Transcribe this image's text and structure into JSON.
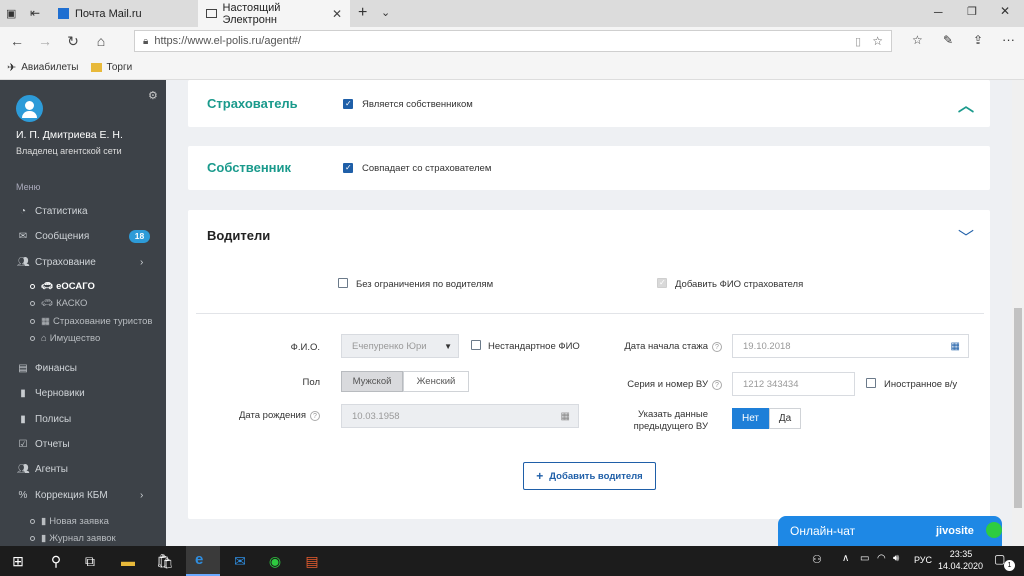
{
  "browser": {
    "tabs": [
      {
        "label": "Почта Mail.ru"
      },
      {
        "label": "Настоящий Электронн"
      }
    ],
    "url": "https://www.el-polis.ru/agent#/",
    "bookmarks": [
      {
        "label": "Авиабилеты"
      },
      {
        "label": "Торги"
      }
    ]
  },
  "sidebar": {
    "user_name": "И. П. Дмитриева Е. Н.",
    "user_role": "Владелец агентской сети",
    "menu_title": "Меню",
    "items": [
      {
        "label": "Статистика",
        "icon": "pie-chart-icon"
      },
      {
        "label": "Сообщения",
        "icon": "envelope-icon",
        "badge": "18"
      },
      {
        "label": "Страхование",
        "icon": "users-icon"
      },
      {
        "label": "Финансы",
        "icon": "money-icon"
      },
      {
        "label": "Черновики",
        "icon": "file-icon"
      },
      {
        "label": "Полисы",
        "icon": "file-icon"
      },
      {
        "label": "Отчеты",
        "icon": "check-icon"
      },
      {
        "label": "Агенты",
        "icon": "users-icon"
      },
      {
        "label": "Коррекция КБМ",
        "icon": "percent-icon"
      }
    ],
    "insurance_sub": [
      {
        "label": "еОСАГО"
      },
      {
        "label": "КАСКО"
      },
      {
        "label": "Страхование туристов"
      },
      {
        "label": "Имущество"
      }
    ],
    "kbm_sub": [
      {
        "label": "Новая заявка"
      },
      {
        "label": "Журнал заявок"
      }
    ]
  },
  "insurer": {
    "title": "Страхователь",
    "checkbox_label": "Является собственником",
    "checked": true
  },
  "owner": {
    "title": "Собственник",
    "checkbox_label": "Совпадает со страхователем",
    "checked": true
  },
  "drivers": {
    "title": "Водители",
    "unlimited_label": "Без ограничения по водителям",
    "add_insurer_label": "Добавить ФИО страхователя",
    "fio_label": "Ф.И.О.",
    "fio_value": "Ечепуренко Юри",
    "nonstandard_label": "Нестандартное ФИО",
    "gender_label": "Пол",
    "gender_male": "Мужской",
    "gender_female": "Женский",
    "dob_label": "Дата рождения",
    "dob_value": "10.03.1958",
    "exp_label": "Дата начала стажа",
    "exp_value": "19.10.2018",
    "license_label": "Серия и номер ВУ",
    "license_value": "1212 343434",
    "foreign_label": "Иностранное в/у",
    "prev_label_1": "Указать данные",
    "prev_label_2": "предыдущего ВУ",
    "prev_no": "Нет",
    "prev_yes": "Да",
    "add_driver": "Добавить водителя"
  },
  "chat": {
    "label": "Онлайн-чат",
    "brand": "jivosite"
  },
  "taskbar": {
    "lang": "РУС",
    "time": "23:35",
    "date": "14.04.2020",
    "notif": "1"
  },
  "colors": {
    "accent": "#1f5fa8",
    "teal": "#1a9a8c",
    "sidebar": "#3d4248"
  }
}
